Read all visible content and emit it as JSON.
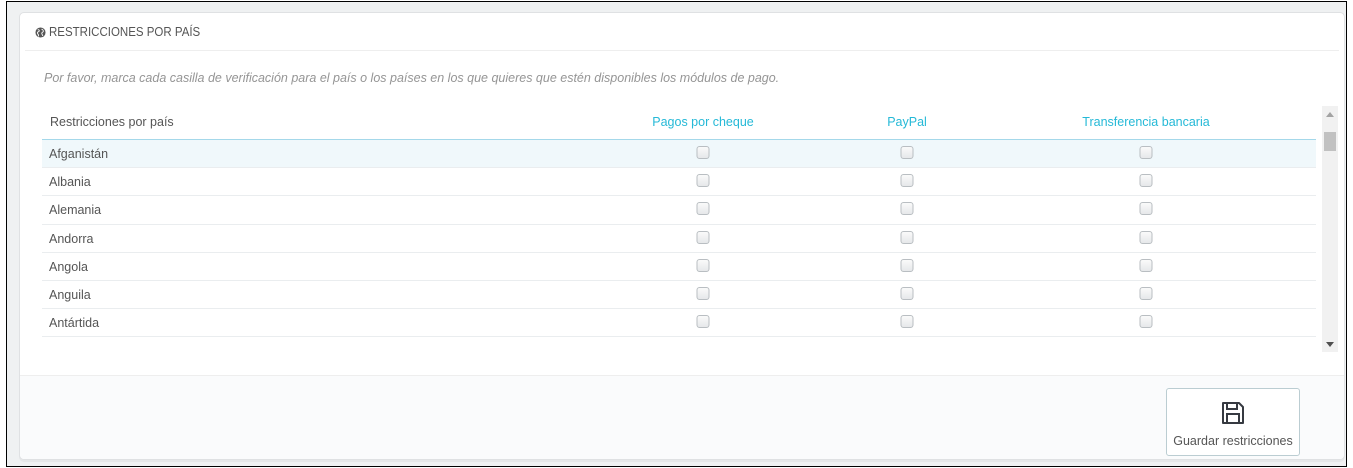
{
  "panel": {
    "title": "RESTRICCIONES POR PAÍS",
    "icon": "globe-icon",
    "help_text": "Por favor, marca cada casilla de verificación para el país o los países en los que quieres que estén disponibles los módulos de pago."
  },
  "table": {
    "headers": {
      "country": "Restricciones por país",
      "modules": [
        "Pagos por cheque",
        "PayPal",
        "Transferencia bancaria"
      ]
    },
    "rows": [
      {
        "country": "Afganistán",
        "checked": [
          false,
          false,
          false
        ]
      },
      {
        "country": "Albania",
        "checked": [
          false,
          false,
          false
        ]
      },
      {
        "country": "Alemania",
        "checked": [
          false,
          false,
          false
        ]
      },
      {
        "country": "Andorra",
        "checked": [
          false,
          false,
          false
        ]
      },
      {
        "country": "Angola",
        "checked": [
          false,
          false,
          false
        ]
      },
      {
        "country": "Anguila",
        "checked": [
          false,
          false,
          false
        ]
      },
      {
        "country": "Antártida",
        "checked": [
          false,
          false,
          false
        ]
      }
    ]
  },
  "footer": {
    "save_label": "Guardar restricciones",
    "save_icon": "floppy-disk-icon"
  },
  "colors": {
    "accent": "#25b9d7",
    "text": "#555555",
    "muted": "#959595"
  }
}
